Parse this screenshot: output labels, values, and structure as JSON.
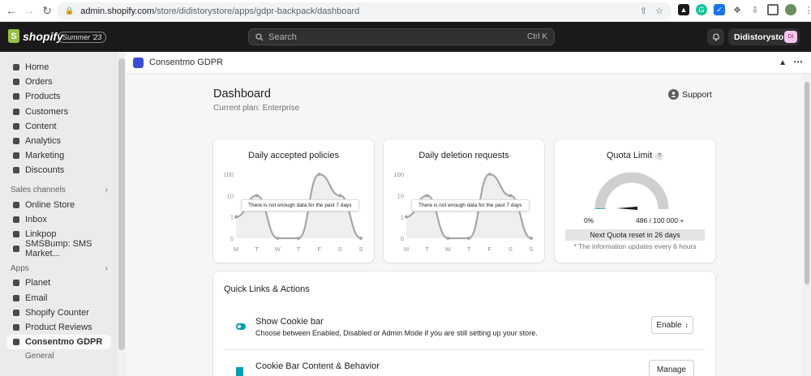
{
  "browser": {
    "url_host": "admin.shopify.com",
    "url_path": "/store/didistorystore/apps/gdpr-backpack/dashboard"
  },
  "topbar": {
    "brand": "shopify",
    "edition": "Summer '23",
    "search_placeholder": "Search",
    "search_shortcut": "Ctrl K",
    "store_name": "Didistorystore",
    "store_initials": "DI"
  },
  "sidebar": {
    "main_items": [
      {
        "label": "Home",
        "icon": "home-icon"
      },
      {
        "label": "Orders",
        "icon": "orders-icon"
      },
      {
        "label": "Products",
        "icon": "tag-icon"
      },
      {
        "label": "Customers",
        "icon": "person-icon"
      },
      {
        "label": "Content",
        "icon": "content-icon"
      },
      {
        "label": "Analytics",
        "icon": "chart-icon"
      },
      {
        "label": "Marketing",
        "icon": "target-icon"
      },
      {
        "label": "Discounts",
        "icon": "discount-icon"
      }
    ],
    "sales_channels_heading": "Sales channels",
    "channels": [
      {
        "label": "Online Store",
        "icon": "store-icon"
      },
      {
        "label": "Inbox",
        "icon": "inbox-icon"
      },
      {
        "label": "Linkpop",
        "icon": "linkpop-icon"
      },
      {
        "label": "SMSBump: SMS Market...",
        "icon": "smsbump-icon"
      }
    ],
    "apps_heading": "Apps",
    "apps": [
      {
        "label": "Planet",
        "icon": "planet-icon"
      },
      {
        "label": "Email",
        "icon": "email-icon"
      },
      {
        "label": "Shopify Counter",
        "icon": "counter-icon"
      },
      {
        "label": "Product Reviews",
        "icon": "star-icon"
      },
      {
        "label": "Consentmo GDPR",
        "icon": "consentmo-icon"
      }
    ],
    "sub_item": "General"
  },
  "app_header": {
    "title": "Consentmo GDPR"
  },
  "dashboard": {
    "title": "Dashboard",
    "plan": "Current plan: Enterprise",
    "support": "Support"
  },
  "charts": {
    "no_data_message": "There is not enough data for the past 7 days",
    "accepted_title": "Daily accepted policies",
    "deletion_title": "Daily deletion requests"
  },
  "chart_data": [
    {
      "type": "area",
      "title": "Daily accepted policies",
      "categories": [
        "M",
        "T",
        "W",
        "T",
        "F",
        "S",
        "S"
      ],
      "y_ticks": [
        "0",
        "1",
        "10",
        "100"
      ],
      "y_scale": "log",
      "values": [
        1,
        10,
        0,
        0,
        100,
        10,
        0
      ]
    },
    {
      "type": "area",
      "title": "Daily deletion requests",
      "categories": [
        "M",
        "T",
        "W",
        "T",
        "F",
        "S",
        "S"
      ],
      "y_ticks": [
        "0",
        "1",
        "10",
        "100"
      ],
      "y_scale": "log",
      "values": [
        1,
        10,
        0,
        0,
        100,
        10,
        0
      ]
    }
  ],
  "quota": {
    "title": "Quota Limit",
    "help": "?",
    "percent_label": "0%",
    "usage": "486 / 100 000 +",
    "used_fraction": 0.005,
    "reset": "Next Quota reset in 26 days",
    "note": "* The information updates every 6 hours"
  },
  "quick_links": {
    "title": "Quick Links & Actions",
    "rows": [
      {
        "title": "Show Cookie bar",
        "desc": "Choose between Enabled, Disabled or Admin Mode if you are still setting up your store.",
        "button": "Enable"
      },
      {
        "title": "Cookie Bar Content & Behavior",
        "desc": "",
        "button": "Manage"
      }
    ]
  },
  "colors": {
    "accent": "#00a0ac",
    "chart_line": "#a6a6a6",
    "topbar": "#1a1a1a"
  }
}
